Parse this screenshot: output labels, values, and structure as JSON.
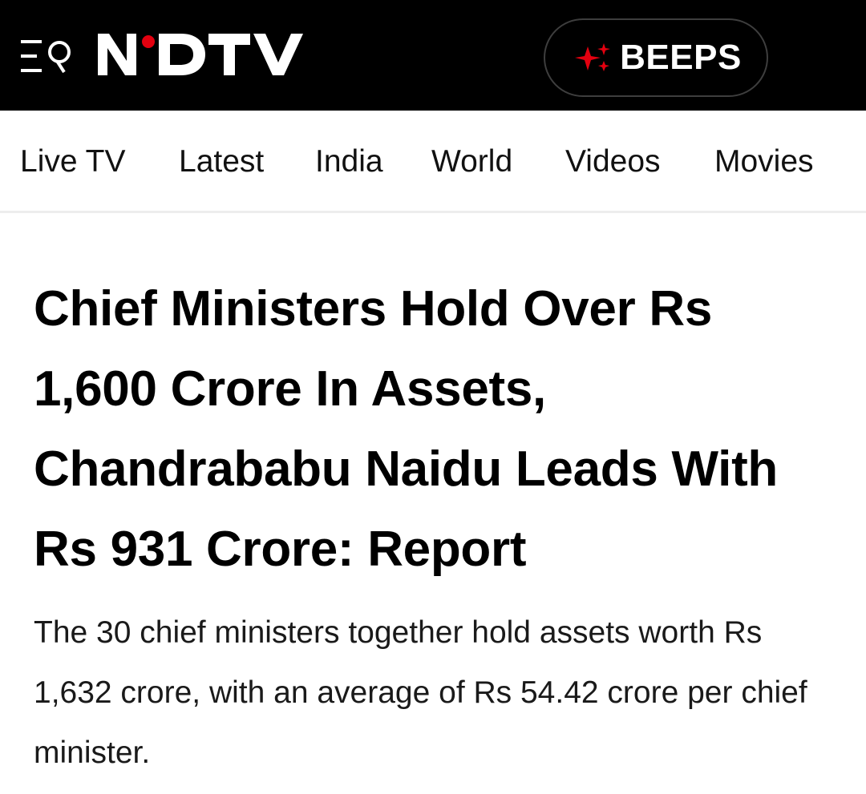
{
  "header": {
    "logo_text": "NDTV",
    "logo_icon": "ndtv-logo",
    "menu_icon": "menu-search-icon",
    "beeps": {
      "label": "BEEPS",
      "icon": "sparkle-icon",
      "accent_color": "#e3000f"
    }
  },
  "nav": {
    "items": [
      {
        "label": "Live TV"
      },
      {
        "label": "Latest"
      },
      {
        "label": "India"
      },
      {
        "label": "World"
      },
      {
        "label": "Videos"
      },
      {
        "label": "Movies"
      }
    ]
  },
  "article": {
    "headline": "Chief Ministers Hold Over Rs 1,600 Crore In Assets, Chandrababu Naidu Leads With Rs 931 Crore: Report",
    "summary": "The 30 chief ministers together hold assets worth Rs 1,632 crore, with an average of Rs 54.42 crore per chief minister."
  },
  "colors": {
    "header_bg": "#000000",
    "brand_red": "#e3000f",
    "text": "#000000"
  }
}
